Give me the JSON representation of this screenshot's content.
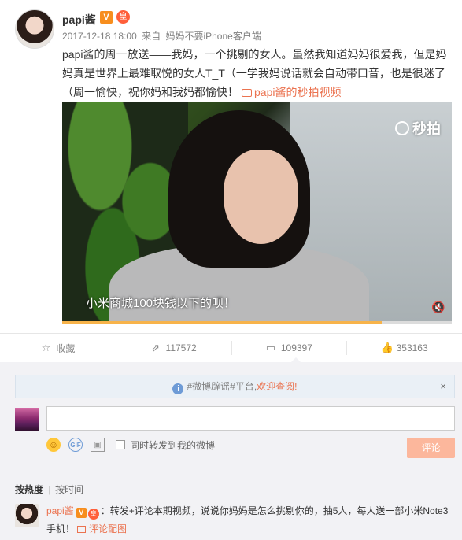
{
  "post": {
    "username": "papi酱",
    "verified_badge": "V",
    "crown_badge": "皇",
    "timestamp": "2017-12-18 18:00",
    "source_prefix": "来自",
    "source": "妈妈不要iPhone客户端",
    "text": "papi酱的周一放送——我妈，一个挑剔的女人。虽然我知道妈妈很爱我，但是妈妈真是世界上最难取悦的女人T_T（一学我妈说话就会自动带口音，也是很迷了（周一愉快，祝你妈和我妈都愉快！",
    "video_link": "papi酱的秒拍视频"
  },
  "video": {
    "watermark": "秒拍",
    "subtitle": "小米商城100块钱以下的呗！",
    "progress_fraction": 0.82
  },
  "actions": {
    "favorite_label": "收藏",
    "forward_count": "117572",
    "comment_count": "109397",
    "like_count": "353163"
  },
  "comment_box": {
    "notice_text": "#微博辟谣#平台,",
    "notice_link": "欢迎查阅!",
    "close_label": "×",
    "input_placeholder": "",
    "forward_label": "同时转发到我的微博",
    "submit_label": "评论"
  },
  "sort": {
    "hot": "按热度",
    "time": "按时间"
  },
  "comment": {
    "name": "papi酱",
    "text": "：转发+评论本期视频，说说你妈妈是怎么挑剔你的，抽5人，每人送一部小米Note3手机！",
    "pic_link": "评论配图"
  },
  "icons": {
    "favorite": "star-icon",
    "forward": "forward-icon",
    "comment": "comment-icon",
    "like": "thumbs-up-icon"
  },
  "colors": {
    "accent": "#eb7350",
    "verified": "#f78e1e",
    "submit_disabled": "#fcb79c"
  }
}
